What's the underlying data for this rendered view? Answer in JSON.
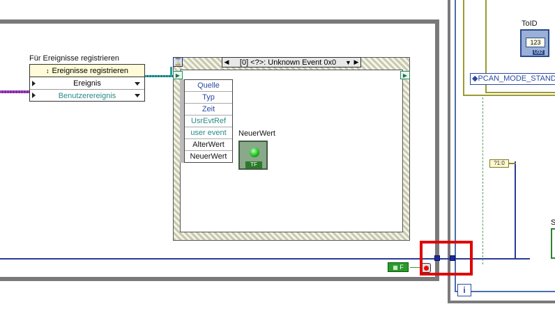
{
  "diagram": {
    "registration": {
      "title": "Für Ereignisse registrieren",
      "header": "Ereignisse registrieren",
      "rows": [
        "Ereignis",
        "Benutzerereignis"
      ]
    },
    "event_structure": {
      "selector": "[0] <?>: Unknown Event 0x0",
      "event_data": [
        "Quelle",
        "Typ",
        "Zeit",
        "UsrEvtRef",
        "user event",
        "AlterWert",
        "NeuerWert"
      ]
    },
    "indicator": {
      "label": "NeuerWert",
      "value": "TF"
    },
    "loop": {
      "false_const": "F",
      "iteration": "i"
    },
    "right": {
      "toid_label": "ToID",
      "toid_value": "123",
      "toid_type": "U32",
      "pcan_label": "PCAN_MODE_STANDARD",
      "unbundle": "?1:0",
      "stub_s": "S"
    }
  },
  "colors": {
    "highlight": "#e00000",
    "loop_wire": "#2a3a9a",
    "event_ref_wire": "#2aa0a0",
    "user_event_wire": "#a040c0"
  }
}
